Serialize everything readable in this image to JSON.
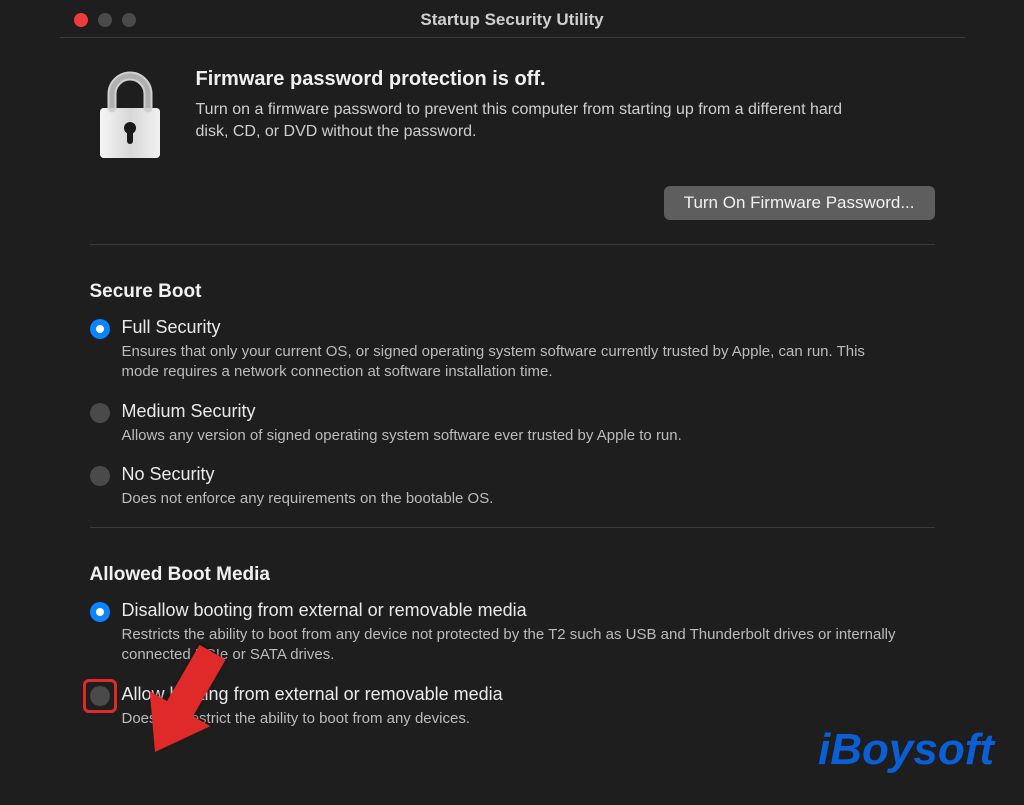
{
  "window": {
    "title": "Startup Security Utility"
  },
  "firmware": {
    "heading": "Firmware password protection is off.",
    "description": "Turn on a firmware password to prevent this computer from starting up from a different hard disk, CD, or DVD without the password.",
    "button_label": "Turn On Firmware Password..."
  },
  "secure_boot": {
    "title": "Secure Boot",
    "options": [
      {
        "label": "Full Security",
        "desc": "Ensures that only your current OS, or signed operating system software currently trusted by Apple, can run. This mode requires a network connection at software installation time.",
        "selected": true
      },
      {
        "label": "Medium Security",
        "desc": "Allows any version of signed operating system software ever trusted by Apple to run.",
        "selected": false
      },
      {
        "label": "No Security",
        "desc": "Does not enforce any requirements on the bootable OS.",
        "selected": false
      }
    ]
  },
  "allowed_boot_media": {
    "title": "Allowed Boot Media",
    "options": [
      {
        "label": "Disallow booting from external or removable media",
        "desc": "Restricts the ability to boot from any device not protected by the T2 such as USB and Thunderbolt drives or internally connected PCIe or SATA drives.",
        "selected": true
      },
      {
        "label": "Allow booting from external or removable media",
        "desc": "Does not restrict the ability to boot from any devices.",
        "selected": false
      }
    ]
  },
  "watermark": "iBoysoft"
}
